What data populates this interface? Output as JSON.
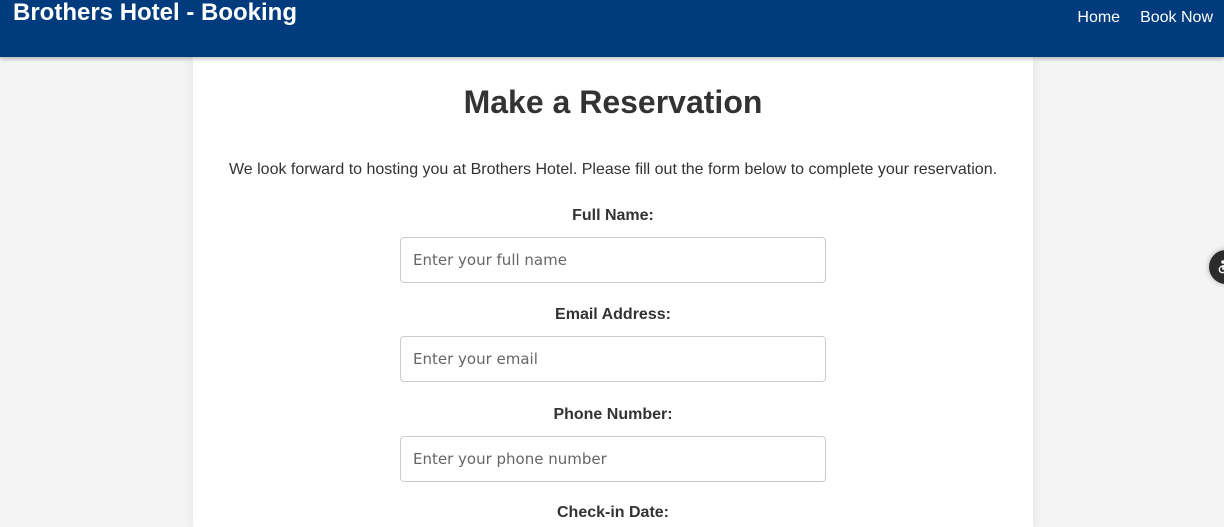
{
  "header": {
    "brand": "Brothers Hotel - Booking",
    "nav": [
      {
        "label": "Home"
      },
      {
        "label": "Book Now"
      }
    ]
  },
  "main": {
    "title": "Make a Reservation",
    "intro": "We look forward to hosting you at Brothers Hotel. Please fill out the form below to complete your reservation.",
    "fields": [
      {
        "label": "Full Name:",
        "placeholder": "Enter your full name",
        "value": ""
      },
      {
        "label": "Email Address:",
        "placeholder": "Enter your email",
        "value": ""
      },
      {
        "label": "Phone Number:",
        "placeholder": "Enter your phone number",
        "value": ""
      },
      {
        "label": "Check-in Date:"
      }
    ]
  },
  "widget": {
    "icon": "accessibility-icon"
  },
  "colors": {
    "header_bg": "#003b7d",
    "page_bg": "#f4f4f4",
    "card_bg": "#ffffff",
    "text": "#333333"
  }
}
